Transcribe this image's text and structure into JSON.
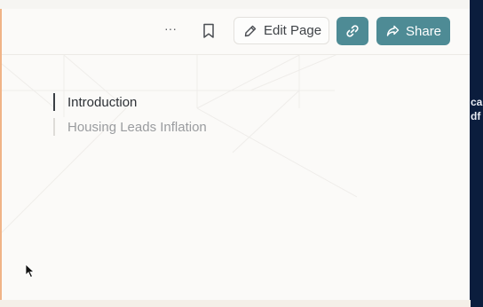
{
  "toolbar": {
    "more_label": "···",
    "edit_label": "Edit Page",
    "share_label": "Share"
  },
  "toc": {
    "items": [
      {
        "label": "Introduction",
        "active": true
      },
      {
        "label": "Housing Leads Inflation",
        "active": false
      }
    ]
  },
  "background_right_text": [
    "ca",
    "df"
  ],
  "colors": {
    "accent": "#4e8b95",
    "page_bg": "#fbfaf8",
    "right_panel": "#0b1d3d"
  }
}
